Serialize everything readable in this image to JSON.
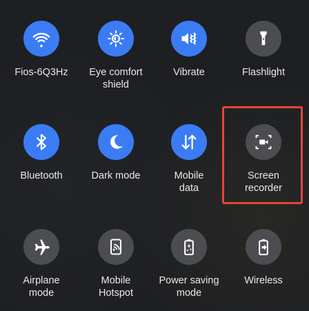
{
  "quick_settings": {
    "tiles": [
      {
        "label": "Fios-6Q3Hz",
        "icon": "wifi-icon",
        "state": "on"
      },
      {
        "label": "Eye comfort\nshield",
        "icon": "eye-comfort-icon",
        "state": "on"
      },
      {
        "label": "Vibrate",
        "icon": "vibrate-icon",
        "state": "on"
      },
      {
        "label": "Flashlight",
        "icon": "flashlight-icon",
        "state": "off"
      },
      {
        "label": "Bluetooth",
        "icon": "bluetooth-icon",
        "state": "on"
      },
      {
        "label": "Dark mode",
        "icon": "moon-icon",
        "state": "on"
      },
      {
        "label": "Mobile\ndata",
        "icon": "mobile-data-icon",
        "state": "on"
      },
      {
        "label": "Screen\nrecorder",
        "icon": "screen-recorder-icon",
        "state": "off"
      },
      {
        "label": "Airplane\nmode",
        "icon": "airplane-icon",
        "state": "off"
      },
      {
        "label": "Mobile\nHotspot",
        "icon": "hotspot-icon",
        "state": "off"
      },
      {
        "label": "Power saving\nmode",
        "icon": "power-saving-icon",
        "state": "off"
      },
      {
        "label": "Wireless",
        "icon": "wireless-share-icon",
        "state": "off"
      }
    ]
  },
  "colors": {
    "active": "#3b7cf4",
    "inactive": "#4b4d51",
    "highlight": "#e8443a"
  }
}
